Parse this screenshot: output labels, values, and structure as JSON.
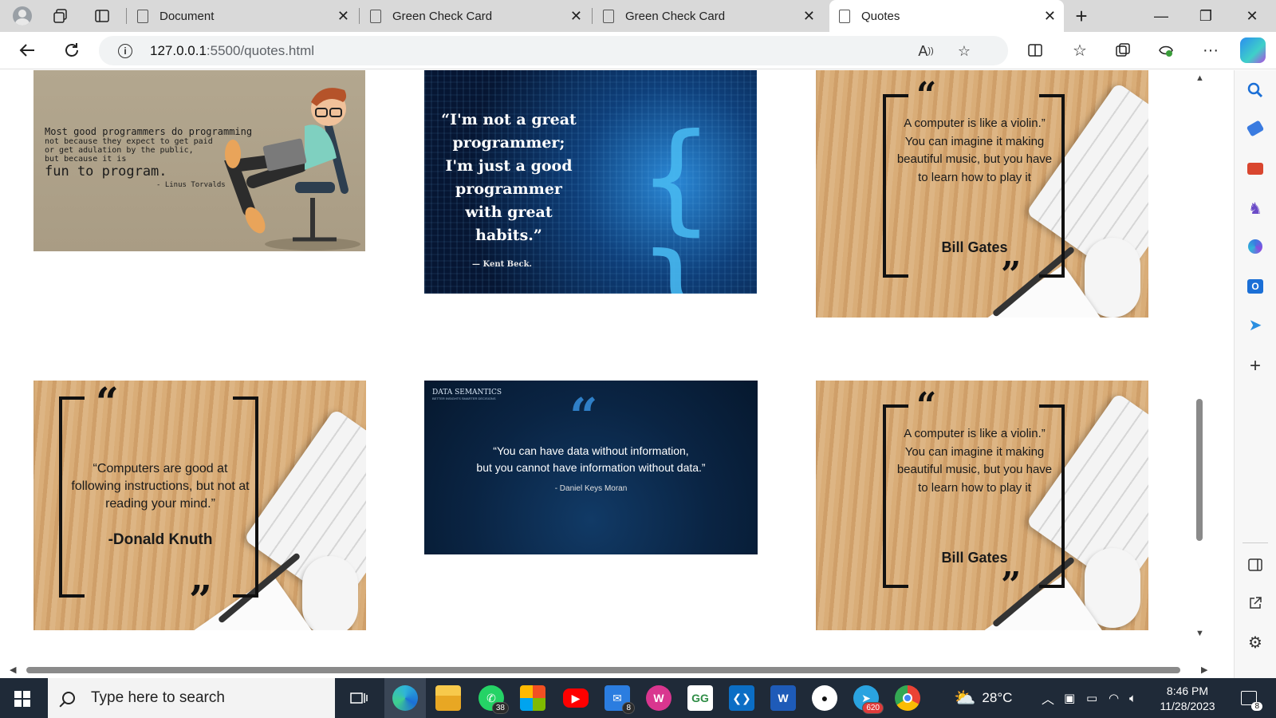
{
  "browser": {
    "tabs": [
      {
        "label": "Document",
        "active": false
      },
      {
        "label": "Green Check Card",
        "active": false
      },
      {
        "label": "Green Check Card",
        "active": false
      },
      {
        "label": "Quotes",
        "active": true
      }
    ],
    "url_host": "127.0.0.1",
    "url_path": ":5500/quotes.html"
  },
  "quotes": {
    "q1": {
      "lines": [
        "Most good programmers do programming",
        "not because they expect to get paid",
        "or get adulation by the public,",
        "but because it is",
        "fun to program."
      ],
      "author": "- Linus Torvalds"
    },
    "q2": {
      "text": "“I'm not a great programmer; I'm just a good programmer with great habits.”",
      "author": "— Kent Beck."
    },
    "q3": {
      "text": "A computer is like a violin.” You can imagine it making beautiful music, but you have to learn how to play it",
      "author": "Bill Gates"
    },
    "q4": {
      "text": "“Computers are good at following instructions, but not at reading your mind.”",
      "author": "-Donald Knuth"
    },
    "q5": {
      "brand": "DATA SEMANTICS",
      "tagline": "BETTER INSIGHTS SMARTER DECISIONS",
      "line1": "“You can have data without information,",
      "line2": "but you cannot have information without data.”",
      "author": "- Daniel Keys Moran"
    },
    "q6": {
      "text": "A computer is like a violin.” You can imagine it making beautiful music, but you have to learn how to play it",
      "author": "Bill Gates"
    }
  },
  "taskbar": {
    "search_placeholder": "Type here to search",
    "whatsapp_badge": "38",
    "mail_badge": "8",
    "telegram_badge": "620",
    "temperature": "28°C",
    "time": "8:46 PM",
    "date": "11/28/2023",
    "notification_count": "8"
  }
}
